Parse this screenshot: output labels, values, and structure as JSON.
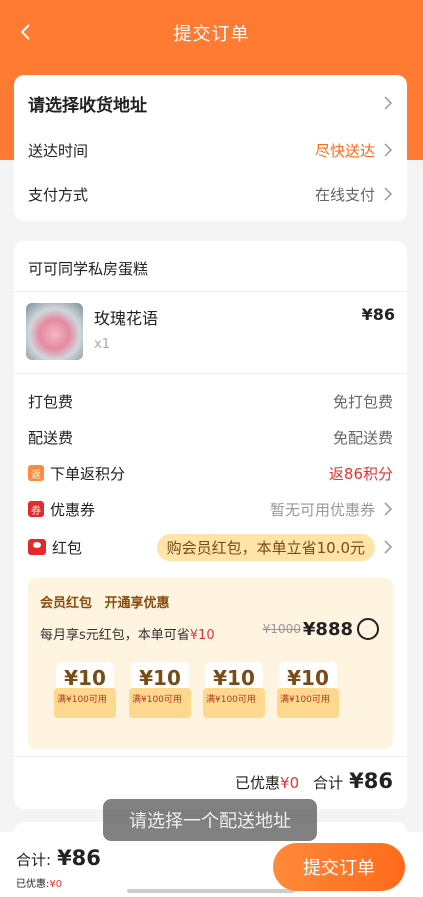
{
  "nav": {
    "title": "提交订单"
  },
  "address_card": {
    "address_label": "请选择收货地址",
    "delivery_time_label": "送达时间",
    "delivery_time_value": "尽快送达",
    "payment_label": "支付方式",
    "payment_value": "在线支付"
  },
  "order": {
    "shop_name": "可可同学私房蛋糕",
    "item": {
      "name": "玫瑰花语",
      "qty": "x1",
      "price": "¥86"
    },
    "packing_label": "打包费",
    "packing_value": "免打包费",
    "delivery_fee_label": "配送费",
    "delivery_fee_value": "免配送费",
    "points_icon": "返",
    "points_label": "下单返积分",
    "points_value": "返86积分",
    "coupon_icon": "券",
    "coupon_label": "优惠券",
    "coupon_value": "暂无可用优惠券",
    "redpack_label": "红包",
    "redpack_value": "购会员红包，本单立省10.0元"
  },
  "member": {
    "title": "会员红包",
    "subtitle": "开通享优惠",
    "desc_prefix": "每月享s元红包，本单可省",
    "desc_save": "¥10",
    "old_price": "¥1000",
    "new_price": "¥888",
    "coupons": [
      {
        "amount": "¥10",
        "cond": "满¥100可用"
      },
      {
        "amount": "¥10",
        "cond": "满¥100可用"
      },
      {
        "amount": "¥10",
        "cond": "满¥100可用"
      },
      {
        "amount": "¥10",
        "cond": "满¥100可用"
      }
    ]
  },
  "summary": {
    "discount_label": "已优惠",
    "discount_value": "¥0",
    "total_label": "合计",
    "total_value": "¥86"
  },
  "toast": "请选择一个配送地址",
  "bottom": {
    "total_label": "合计:",
    "total_value": "¥86",
    "discount_label": "已优惠:",
    "discount_value": "¥0",
    "submit_label": "提交订单"
  },
  "colors": {
    "accent": "#ff7a32",
    "red": "#e73232",
    "member_bg": "#fff4df"
  }
}
